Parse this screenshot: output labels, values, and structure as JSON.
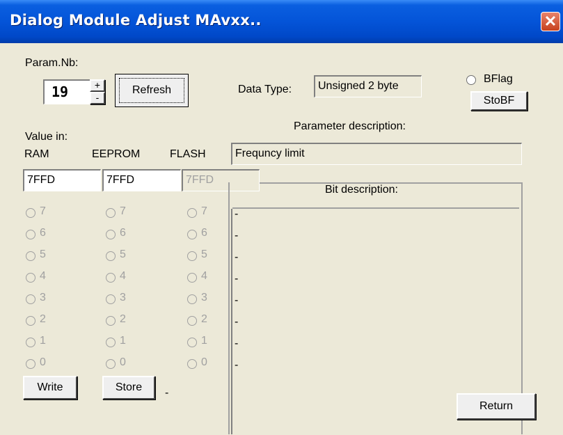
{
  "window": {
    "title": "Dialog Module Adjust MAvxx..",
    "close_glyph": "✕"
  },
  "param": {
    "label": "Param.Nb:",
    "value": "19",
    "up": "+",
    "down": "-"
  },
  "buttons": {
    "refresh": "Refresh",
    "stobf": "StoBF",
    "write": "Write",
    "store": "Store",
    "return": "Return"
  },
  "datatype": {
    "label": "Data Type:",
    "value": "Unsigned 2 byte"
  },
  "bflag": {
    "label": "BFlag"
  },
  "param_description": {
    "label": "Parameter description:",
    "value": "Frequncy limit"
  },
  "value_in": {
    "label": "Value in:"
  },
  "columns": {
    "ram": {
      "label": "RAM",
      "value": "7FFD"
    },
    "eeprom": {
      "label": "EEPROM",
      "value": "7FFD"
    },
    "flash": {
      "label": "FLASH",
      "value": "7FFD"
    }
  },
  "bits": [
    "7",
    "6",
    "5",
    "4",
    "3",
    "2",
    "1",
    "0"
  ],
  "bit_description": {
    "label": "Bit description:",
    "items": [
      "-",
      "-",
      "-",
      "-",
      "-",
      "-",
      "-",
      "-"
    ]
  },
  "status": {
    "dash": "-"
  }
}
